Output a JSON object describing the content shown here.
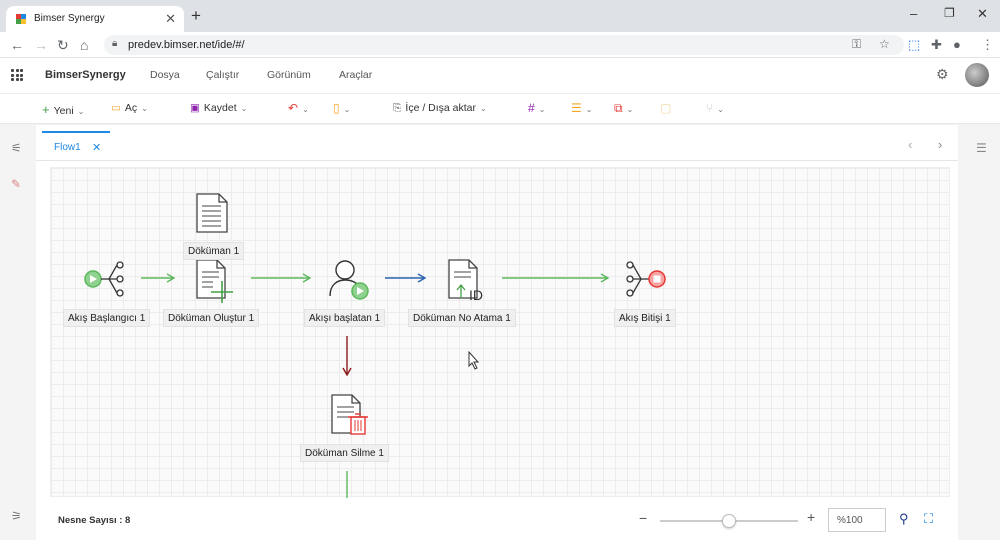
{
  "browser": {
    "tab_title": "Bimser Synergy",
    "url": "predev.bimser.net/ide/#/",
    "minimize": "–",
    "maximize": "❐",
    "close": "✕"
  },
  "app": {
    "name": "BimserSynergy",
    "menu": [
      "Dosya",
      "Çalıştır",
      "Görünüm",
      "Araçlar"
    ]
  },
  "toolbar": {
    "new_label": "Yeni",
    "open_label": "Aç",
    "save_label": "Kaydet",
    "import_export_label": "İçe / Dışa aktar"
  },
  "editor": {
    "tab_label": "Flow1"
  },
  "flow": {
    "nodes": {
      "start": "Akış Başlangıcı 1",
      "doc1": "Döküman 1",
      "create": "Döküman Oluştur 1",
      "initiator": "Akışı başlatan 1",
      "numbering": "Döküman No Atama 1",
      "end": "Akış Bitişi 1",
      "delete": "Döküman Silme 1"
    }
  },
  "status": {
    "object_count": "Nesne Sayısı : 8",
    "zoom": "%100",
    "zoom_percent": 50
  },
  "colors": {
    "accent": "#1e88e5",
    "green": "#5cb85c",
    "red": "#e53935",
    "dark_red": "#8b1a1a",
    "blue_arrow": "#2b62b0"
  }
}
